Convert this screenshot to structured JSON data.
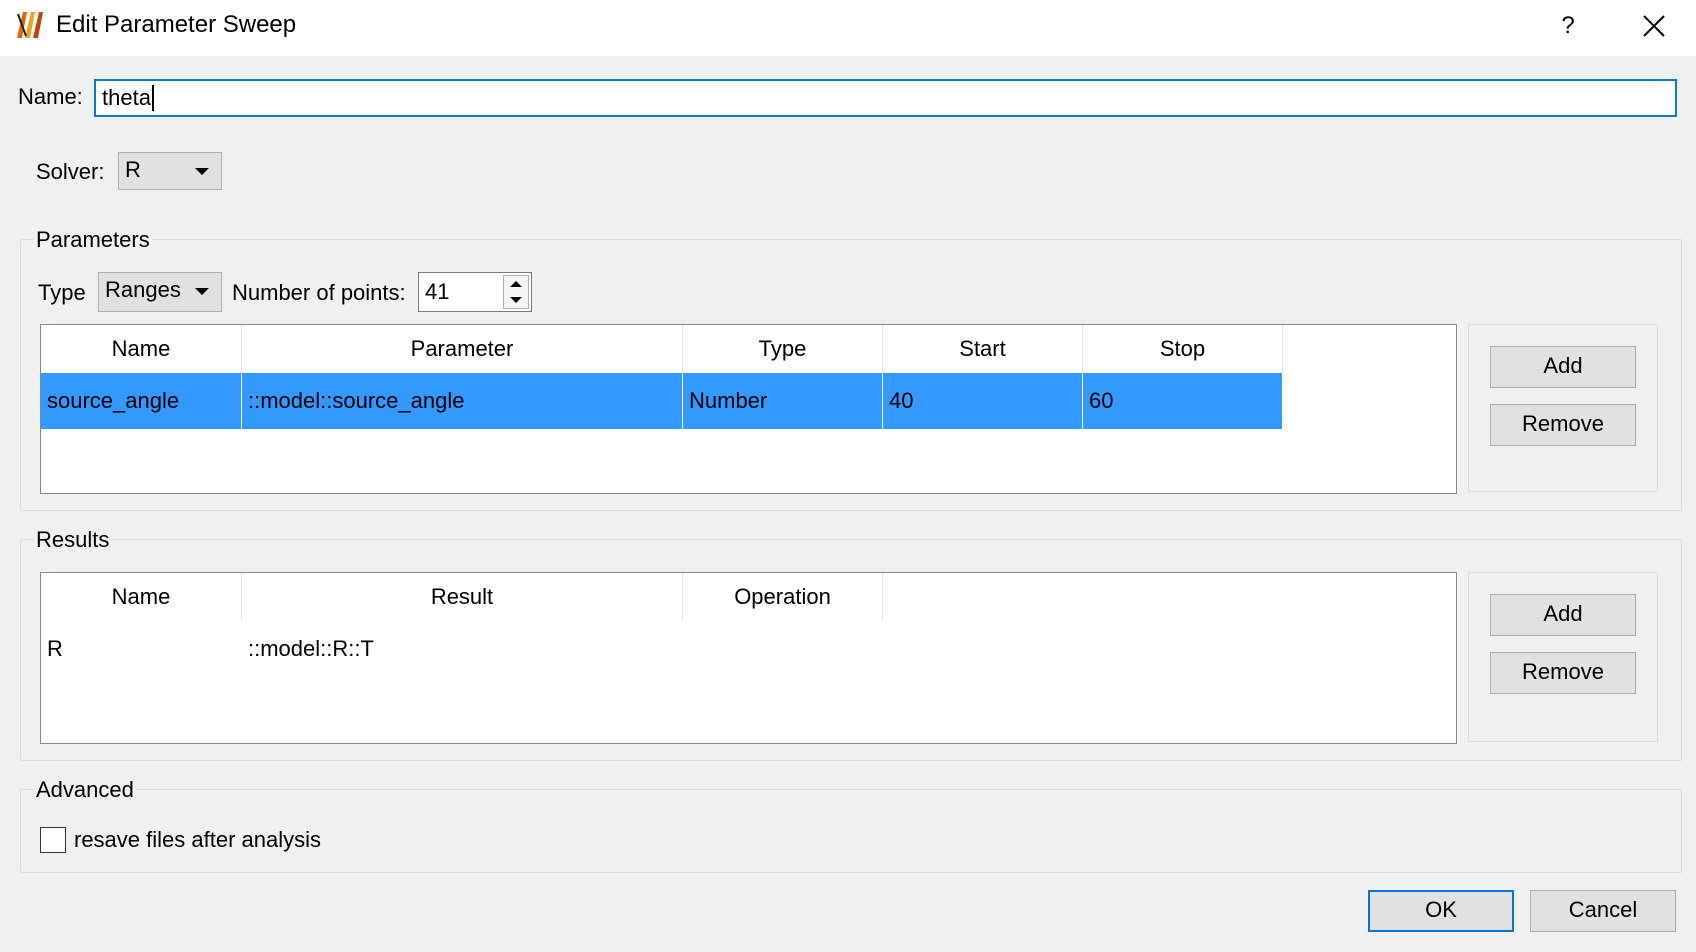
{
  "window": {
    "title": "Edit Parameter Sweep",
    "help_label": "?",
    "logo_icon": "app-logo-icon",
    "close_icon": "close-icon"
  },
  "name_field": {
    "label": "Name:",
    "value": "theta"
  },
  "solver": {
    "label": "Solver:",
    "selected": "R"
  },
  "parameters": {
    "group_title": "Parameters",
    "type_label": "Type",
    "type_selected": "Ranges",
    "points_label": "Number of points:",
    "points_value": "41",
    "columns": [
      "Name",
      "Parameter",
      "Type",
      "Start",
      "Stop"
    ],
    "rows": [
      {
        "name": "source_angle",
        "parameter": "::model::source_angle",
        "type": "Number",
        "start": "40",
        "stop": "60",
        "selected": true
      }
    ],
    "add_label": "Add",
    "remove_label": "Remove"
  },
  "results": {
    "group_title": "Results",
    "columns": [
      "Name",
      "Result",
      "Operation"
    ],
    "rows": [
      {
        "name": "R",
        "result": "::model::R::T",
        "operation": ""
      }
    ],
    "add_label": "Add",
    "remove_label": "Remove"
  },
  "advanced": {
    "group_title": "Advanced",
    "resave_label": "resave files after analysis",
    "resave_checked": false
  },
  "footer": {
    "ok_label": "OK",
    "cancel_label": "Cancel"
  },
  "colors": {
    "selection": "#3399ff",
    "focus_border": "#0078d7",
    "logo": "#e8620c"
  }
}
